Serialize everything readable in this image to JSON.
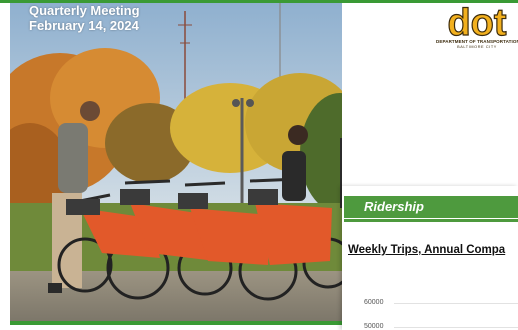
{
  "slide": {
    "title_line1": "Quarterly Meeting",
    "title_line2": "February 14, 2024",
    "accent_color": "#3a9a35"
  },
  "logo": {
    "mark": "dot",
    "subtitle1": "DEPARTMENT OF TRANSPORTATION",
    "subtitle2": "BALTIMORE CITY",
    "colors": {
      "mark": "#f2b01e",
      "stroke": "#3b2a0c"
    }
  },
  "photo": {
    "description_icon": "photo-bikeshare-riders"
  },
  "card": {
    "header": "Ridership",
    "chart_title": "Weekly Trips, Annual Compa",
    "header_color": "#4e9a3e"
  },
  "chart_data": {
    "type": "line",
    "title": "Weekly Trips, Annual Compa",
    "y_ticks": [
      "60000",
      "50000"
    ],
    "series": []
  }
}
